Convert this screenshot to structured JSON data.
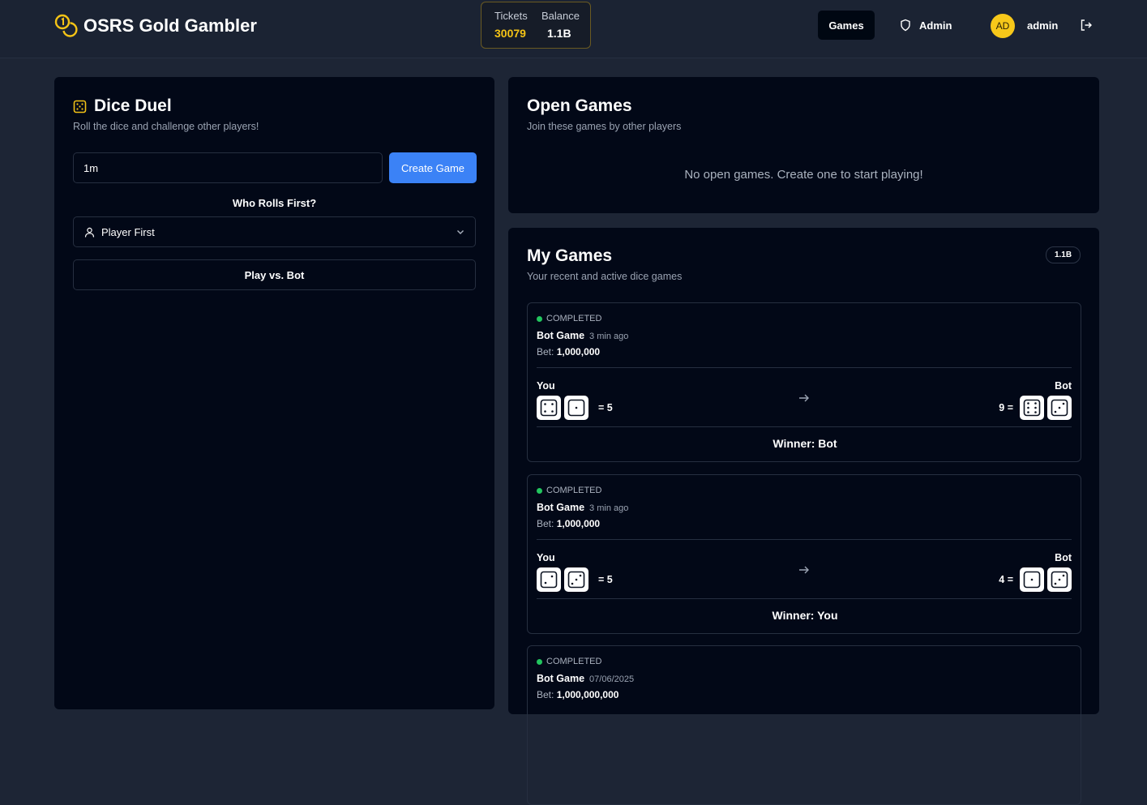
{
  "header": {
    "app_title": "OSRS Gold Gambler",
    "tickets_label": "Tickets",
    "tickets_value": "30079",
    "balance_label": "Balance",
    "balance_value": "1.1B",
    "nav_games": "Games",
    "nav_admin": "Admin",
    "avatar_initials": "AD",
    "username": "admin"
  },
  "dice_duel": {
    "title": "Dice Duel",
    "subtitle": "Roll the dice and challenge other players!",
    "amount_value": "1m",
    "create_button": "Create Game",
    "who_rolls_label": "Who Rolls First?",
    "roll_order_selected": "Player First",
    "play_bot_button": "Play vs. Bot"
  },
  "open_games": {
    "title": "Open Games",
    "subtitle": "Join these games by other players",
    "empty_message": "No open games. Create one to start playing!"
  },
  "my_games": {
    "title": "My Games",
    "subtitle": "Your recent and active dice games",
    "badge": "1.1B",
    "games": [
      {
        "status": "COMPLETED",
        "title": "Bot Game",
        "time": "3 min ago",
        "bet_label": "Bet:",
        "bet_value": "1,000,000",
        "you_label": "You",
        "opponent_label": "Bot",
        "you_dice": [
          4,
          1
        ],
        "you_sum": "= 5",
        "opponent_dice": [
          6,
          3
        ],
        "opponent_sum": "9 =",
        "winner": "Winner: Bot"
      },
      {
        "status": "COMPLETED",
        "title": "Bot Game",
        "time": "3 min ago",
        "bet_label": "Bet:",
        "bet_value": "1,000,000",
        "you_label": "You",
        "opponent_label": "Bot",
        "you_dice": [
          2,
          3
        ],
        "you_sum": "= 5",
        "opponent_dice": [
          1,
          3
        ],
        "opponent_sum": "4 =",
        "winner": "Winner: You"
      },
      {
        "status": "COMPLETED",
        "title": "Bot Game",
        "time": "07/06/2025",
        "bet_label": "Bet:",
        "bet_value": "1,000,000,000"
      }
    ]
  },
  "colors": {
    "accent_gold": "#f4c316",
    "primary_blue": "#3b82f6",
    "status_green": "#22c55e",
    "panel_bg": "#020817",
    "page_bg": "#1d2535"
  },
  "icons": {
    "logo": "coins-icon",
    "dice_duel": "dice-icon",
    "admin": "shield-icon",
    "roll_order": "user-icon",
    "select_caret": "chevron-down-icon",
    "logout": "logout-icon",
    "versus": "arrow-right-icon"
  }
}
